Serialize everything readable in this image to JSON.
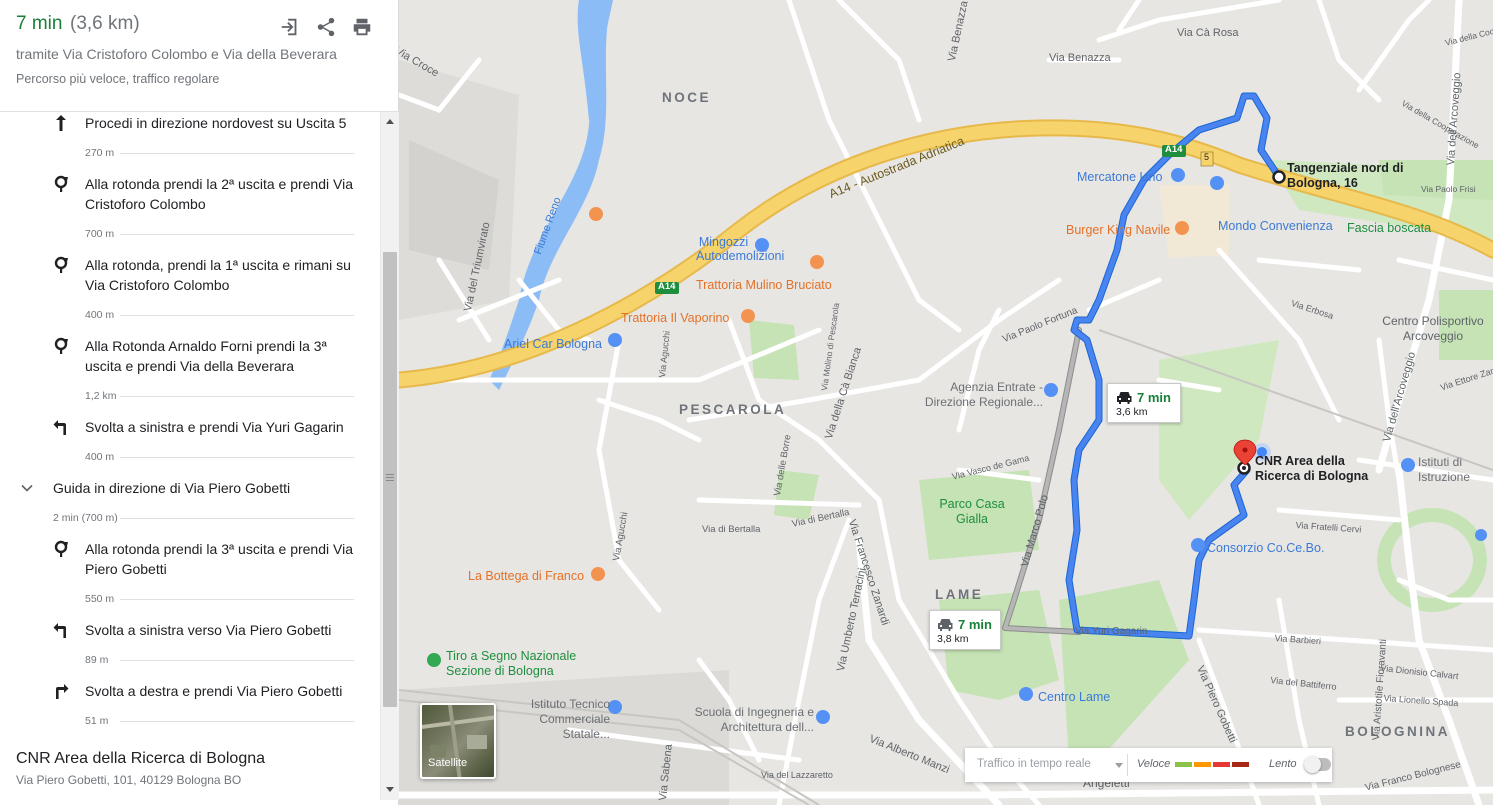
{
  "header": {
    "time": "7 min",
    "distance": "(3,6 km)",
    "via": "tramite Via Cristoforo Colombo e Via della Beverara",
    "status": "Percorso più veloce, traffico regolare",
    "icons": [
      "send-to-device-icon",
      "share-icon",
      "print-icon"
    ]
  },
  "steps": [
    {
      "icon": "arrow-up-icon",
      "text": "Procedi in direzione nordovest su Uscita 5",
      "distance": "270 m"
    },
    {
      "icon": "roundabout-icon",
      "text": "Alla rotonda prendi la 2ª uscita e prendi Via Cristoforo Colombo",
      "distance": "700 m"
    },
    {
      "icon": "roundabout-icon",
      "text": "Alla rotonda, prendi la 1ª uscita e rimani su Via Cristoforo Colombo",
      "distance": "400 m"
    },
    {
      "icon": "roundabout-icon",
      "text": "Alla Rotonda Arnaldo Forni prendi la 3ª uscita e prendi Via della Beverara",
      "distance": "1,2 km"
    },
    {
      "icon": "turn-left-icon",
      "text": "Svolta a sinistra e prendi Via Yuri Gagarin",
      "distance": "400 m"
    }
  ],
  "group": {
    "icon": "chevron-down-icon",
    "title": "Guida in direzione di Via Piero Gobetti",
    "summary": "2 min (700 m)"
  },
  "group_steps": [
    {
      "icon": "roundabout-icon",
      "text": "Alla rotonda prendi la 3ª uscita e prendi Via Piero Gobetti",
      "distance": "550 m"
    },
    {
      "icon": "turn-left-icon",
      "text": "Svolta a sinistra verso Via Piero Gobetti",
      "distance": "89 m"
    },
    {
      "icon": "turn-right-icon",
      "text": "Svolta a destra e prendi Via Piero Gobetti",
      "distance": "51 m"
    }
  ],
  "destination": {
    "name": "CNR Area della Ricerca di Bologna",
    "address": "Via Piero Gobetti, 101, 40129 Bologna BO"
  },
  "map": {
    "areas": [
      "NOCE",
      "PESCAROLA",
      "LAME",
      "BOLOGNINA"
    ],
    "streets": [
      "Via Cà Rosa",
      "Via Benazza",
      "Via Benazza",
      "Via Croce",
      "A14 - Autostrada Adriatica",
      "A14",
      "A14",
      "5",
      "Fiume Reno",
      "Via del Triumvirato",
      "Via Paolo Fortuna",
      "Via della Cà Bianca",
      "Via Francesco Zanardi",
      "Via Marco Polo",
      "Via Yuri Gagarin",
      "Via Umberto Terracini",
      "Via Agucchi",
      "Via di Bertalla",
      "Via di Bertalla",
      "Via delle Borre",
      "Via Piero Gobetti",
      "Via Aristotile Fioravanti",
      "Via dell'Arcoveggio",
      "Via dell'Arcoveggio",
      "Via Erbosa",
      "Via Ettore Zanibon",
      "Via Fratelli Cervi",
      "Via Barbieri",
      "Via Dionisio Calvart",
      "Via del Battiferro",
      "Via Lionello Spada",
      "Via Franco Bolognese",
      "Via Alberto Manzi",
      "Via del Lazzaretto",
      "Via Vasco de Gama",
      "Via Paolo Frisi",
      "Via della Cooperazione",
      "Via della Cooperazione",
      "Via Agucchi",
      "Via Molino di Pescarola",
      "Via Sabena"
    ],
    "pois_blue": [
      "Mercatone Uno",
      "Mondo Convenienza",
      "Mingozzi Autodemolizioni",
      "Ariel Car Bologna",
      "Agenzia Entrate - Direzione Regionale...",
      "Consorzio Co.Ce.Bo.",
      "Centro Lame",
      "Istituto Tecnico Commerciale Statale...",
      "Scuola di Ingegneria e Architettura dell...",
      "Istituti di Istruzione Superiore Aldini"
    ],
    "pois_orange": [
      "Burger King Navile",
      "Trattoria Mulino Bruciato",
      "Trattoria Il Vaporino",
      "La Bottega di Franco"
    ],
    "pois_green": [
      "Parco Casa Gialla",
      "Fascia boscata",
      "Tiro a Segno Nazionale Sezione di Bologna",
      "Centro Polisportivo Arcoveggio"
    ],
    "poi_gray": [
      "Angeletti"
    ],
    "start_label": "Tangenziale nord di Bologna, 16",
    "end_label": "CNR Area della Ricerca di Bologna",
    "route_main": {
      "time": "7 min",
      "distance": "3,6 km",
      "icon": "car-icon"
    },
    "route_alt": {
      "time": "7 min",
      "distance": "3,8 km",
      "icon": "car-icon"
    },
    "satellite_label": "Satellite",
    "traffic": {
      "live_label": "Traffico in tempo reale",
      "fast_label": "Veloce",
      "slow_label": "Lento",
      "colors": [
        "#8bc34a",
        "#ff9800",
        "#e53935",
        "#a52714"
      ]
    },
    "colors": {
      "route": "#4a84f0",
      "alt_route": "#a0a0a0",
      "highway": "#f6d36b",
      "river": "#8bbcf5",
      "park": "#c5e3b4",
      "accent": "#188038"
    }
  }
}
